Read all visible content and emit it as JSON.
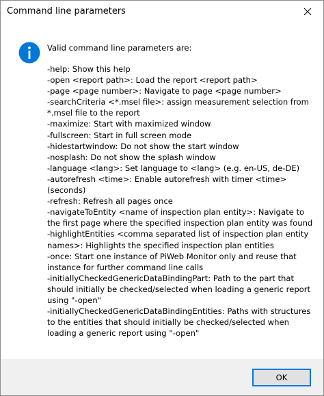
{
  "window": {
    "title": "Command line parameters"
  },
  "message": {
    "heading": "Valid command line parameters are:",
    "params": [
      "-help: Show this help",
      "-open <report path>: Load the report <report path>",
      "-page <page number>: Navigate to page <page number>",
      "-searchCriteria <*.msel file>: assign measurement selection from *.msel file to the report",
      "-maximize: Start with maximized window",
      "-fullscreen: Start in full screen mode",
      "-hidestartwindow: Do not show the start window",
      "-nosplash: Do not show the splash window",
      "-language <lang>: Set language to <lang> (e.g. en-US, de-DE)",
      "-autorefresh <time>: Enable autorefresh with timer <time> (seconds)",
      "-refresh: Refresh all pages once",
      "-navigateToEntity <name of inspection plan entity>: Navigate to the first page where the specified inspection plan entity was found",
      "-highlightEntities <comma separated list of inspection plan entity names>: Highlights the specified inspection plan entities",
      "-once: Start one instance of PiWeb Monitor only and reuse that instance for further command line calls",
      "-initiallyCheckedGenericDataBindingPart: Path to the part that should initially be checked/selected when loading a generic report using \"-open\"",
      "-initiallyCheckedGenericDataBindingEntities: Paths with structures to the entities that should initially be checked/selected when loading a generic report using \"-open\""
    ]
  },
  "buttons": {
    "ok_label": "OK"
  },
  "icons": {
    "info": "info-icon",
    "close": "close-icon"
  },
  "colors": {
    "info_icon": "#0078d7",
    "button_border": "#0078d7",
    "footer_bg": "#f0f0f0"
  }
}
